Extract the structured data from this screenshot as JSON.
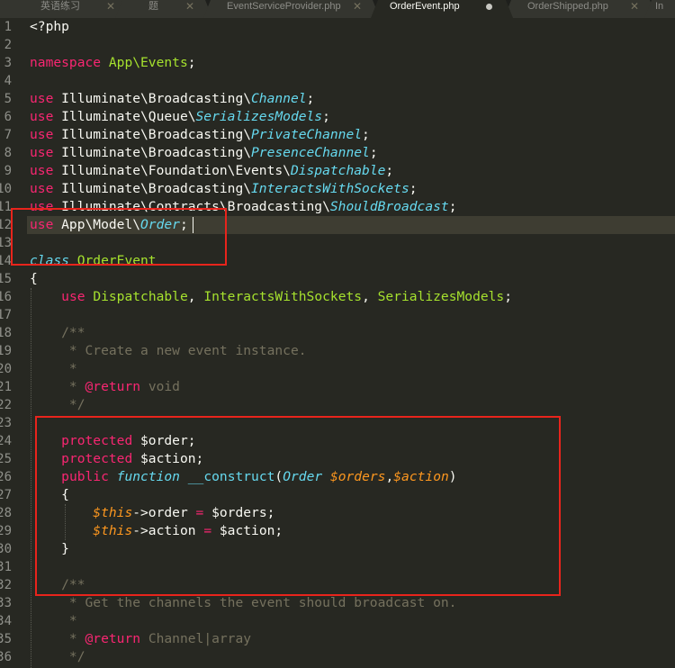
{
  "tabs": [
    {
      "label": "英语练习",
      "active": false,
      "modified": false
    },
    {
      "label": "题",
      "active": false,
      "modified": false
    },
    {
      "label": "EventServiceProvider.php",
      "active": false,
      "modified": false
    },
    {
      "label": "OrderEvent.php",
      "active": true,
      "modified": true
    },
    {
      "label": "OrderShipped.php",
      "active": false,
      "modified": false
    },
    {
      "label": "In",
      "active": false,
      "modified": false
    }
  ],
  "tab_close_glyph": "✕",
  "line_numbers": [
    "1",
    "2",
    "3",
    "4",
    "5",
    "6",
    "7",
    "8",
    "9",
    "10",
    "11",
    "12",
    "13",
    "14",
    "15",
    "16",
    "17",
    "18",
    "19",
    "20",
    "21",
    "22",
    "23",
    "24",
    "25",
    "26",
    "27",
    "28",
    "29",
    "30",
    "31",
    "32",
    "33",
    "34",
    "35",
    "36"
  ],
  "code": {
    "l1": {
      "t1": "<?php"
    },
    "l3": {
      "t1": "namespace",
      "t2": " ",
      "t3": "App\\Events",
      "t4": ";"
    },
    "l5": {
      "t1": "use",
      "t2": " Illuminate\\Broadcasting\\",
      "t3": "Channel",
      "t4": ";"
    },
    "l6": {
      "t1": "use",
      "t2": " Illuminate\\Queue\\",
      "t3": "SerializesModels",
      "t4": ";"
    },
    "l7": {
      "t1": "use",
      "t2": " Illuminate\\Broadcasting\\",
      "t3": "PrivateChannel",
      "t4": ";"
    },
    "l8": {
      "t1": "use",
      "t2": " Illuminate\\Broadcasting\\",
      "t3": "PresenceChannel",
      "t4": ";"
    },
    "l9": {
      "t1": "use",
      "t2": " Illuminate\\Foundation\\Events\\",
      "t3": "Dispatchable",
      "t4": ";"
    },
    "l10": {
      "t1": "use",
      "t2": " Illuminate\\Broadcasting\\",
      "t3": "InteractsWithSockets",
      "t4": ";"
    },
    "l11": {
      "t1": "use",
      "t2": " Illuminate\\Contracts\\Broadcasting\\",
      "t3": "ShouldBroadcast",
      "t4": ";"
    },
    "l12": {
      "t1": "use",
      "t2": " App\\Model\\",
      "t3": "Order",
      "t4": ";"
    },
    "l14": {
      "t1": "class",
      "t2": " ",
      "t3": "OrderEvent"
    },
    "l15": {
      "t1": "{"
    },
    "l16": {
      "t0": "    ",
      "t1": "use",
      "t2": " ",
      "t3": "Dispatchable",
      "t4": ", ",
      "t5": "InteractsWithSockets",
      "t6": ", ",
      "t7": "SerializesModels",
      "t8": ";"
    },
    "l18": {
      "t1": "    /**"
    },
    "l19": {
      "t1": "     * Create a new event instance."
    },
    "l20": {
      "t1": "     *"
    },
    "l21": {
      "t0": "     * ",
      "t1": "@return",
      "t2": " void"
    },
    "l22": {
      "t1": "     */"
    },
    "l24": {
      "t0": "    ",
      "t1": "protected",
      "t2": " $order;"
    },
    "l25": {
      "t0": "    ",
      "t1": "protected",
      "t2": " $action;"
    },
    "l26": {
      "t0": "    ",
      "t1": "public",
      "t2": " ",
      "t3": "function",
      "t4": " ",
      "t5": "__construct",
      "t6": "(",
      "t7": "Order",
      "t8": " ",
      "t9": "$orders",
      "t10": ",",
      "t11": "$action",
      "t12": ")"
    },
    "l27": {
      "t1": "    {"
    },
    "l28": {
      "t0": "        ",
      "t1": "$this",
      "t2": "->order ",
      "t3": "=",
      "t4": " $orders;"
    },
    "l29": {
      "t0": "        ",
      "t1": "$this",
      "t2": "->action ",
      "t3": "=",
      "t4": " $action;"
    },
    "l30": {
      "t1": "    }"
    },
    "l32": {
      "t1": "    /**"
    },
    "l33": {
      "t1": "     * Get the channels the event should broadcast on."
    },
    "l34": {
      "t1": "     *"
    },
    "l35": {
      "t0": "     * ",
      "t1": "@return",
      "t2": " Channel|array"
    },
    "l36": {
      "t1": "     */"
    }
  },
  "colors": {
    "background": "#272822",
    "keyword": "#f92672",
    "type": "#66d9ef",
    "class_name": "#a6e22e",
    "comment": "#75715e",
    "parameter": "#fd971f",
    "annotation_box": "#e8241c"
  }
}
